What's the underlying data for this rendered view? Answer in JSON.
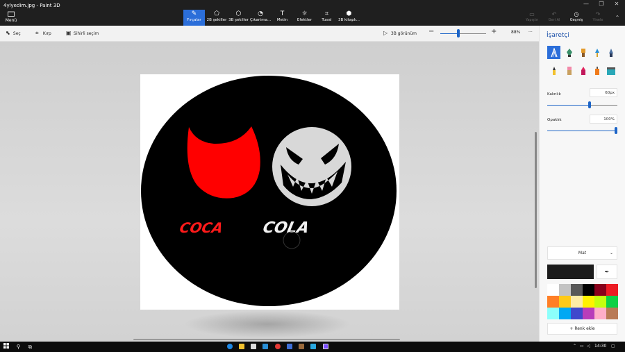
{
  "window": {
    "title": "4ylyedim.jpg - Paint 3D",
    "controls": [
      "—",
      "❐",
      "✕"
    ]
  },
  "menu": {
    "icon": "folder-icon",
    "label": "Menü"
  },
  "ribbon": {
    "tools": [
      {
        "label": "Fırçalar",
        "icon": "brush-icon",
        "active": true
      },
      {
        "label": "2B şekiller",
        "icon": "2d-shapes-icon",
        "active": false
      },
      {
        "label": "3B şekiller",
        "icon": "3d-shapes-icon",
        "active": false
      },
      {
        "label": "Çıkartma...",
        "icon": "sticker-icon",
        "active": false
      },
      {
        "label": "Metin",
        "icon": "text-icon",
        "active": false
      },
      {
        "label": "Efektler",
        "icon": "effects-icon",
        "active": false
      },
      {
        "label": "Tuval",
        "icon": "canvas-icon",
        "active": false
      },
      {
        "label": "3B kitaplı...",
        "icon": "3d-library-icon",
        "active": false
      }
    ],
    "right": [
      {
        "label": "Yapıştır",
        "icon": "paste-icon",
        "enabled": false
      },
      {
        "label": "Geri Al",
        "icon": "undo-icon",
        "enabled": false
      },
      {
        "label": "Geçmiş",
        "icon": "history-icon",
        "enabled": true
      },
      {
        "label": "Yinele",
        "icon": "redo-icon",
        "enabled": false
      }
    ]
  },
  "toolbar": {
    "select_label": "Seç",
    "crop_label": "Kırp",
    "magic_select_label": "Sihirli seçim",
    "view3d_label": "3B görünüm",
    "zoom_minus": "−",
    "zoom_plus": "+",
    "zoom_value": "88%",
    "zoom_level": 0.4,
    "more": "···"
  },
  "canvas": {
    "logo_text_red": "COCA",
    "logo_text_white": "COLA"
  },
  "panel": {
    "title": "İşaretçi",
    "brushes": [
      {
        "name": "marker",
        "selected": true
      },
      {
        "name": "calligraphy-pen"
      },
      {
        "name": "oil-brush"
      },
      {
        "name": "watercolor"
      },
      {
        "name": "pixel-pen"
      },
      {
        "name": "pencil"
      },
      {
        "name": "eraser"
      },
      {
        "name": "crayon"
      },
      {
        "name": "spray-can"
      },
      {
        "name": "fill"
      }
    ],
    "thickness_label": "Kalınlık",
    "thickness_value": "60px",
    "thickness_level": 0.6,
    "opacity_label": "Opaklık",
    "opacity_value": "100%",
    "opacity_level": 1.0,
    "finish_label": "Mat",
    "current_color": "#1c1c1c",
    "palette": [
      "#ffffff",
      "#c3c3c3",
      "#585858",
      "#000000",
      "#88001b",
      "#ec1c24",
      "#ff7f27",
      "#ffca18",
      "#fdeca6",
      "#fff200",
      "#c4ff0e",
      "#0ed145",
      "#8cfffb",
      "#00a8f3",
      "#3f48cc",
      "#b83dba",
      "#ffaec8",
      "#b97a56"
    ],
    "add_color_label": "Renk ekle"
  },
  "taskbar": {
    "time": "14:30",
    "accent": "#0078d7"
  }
}
